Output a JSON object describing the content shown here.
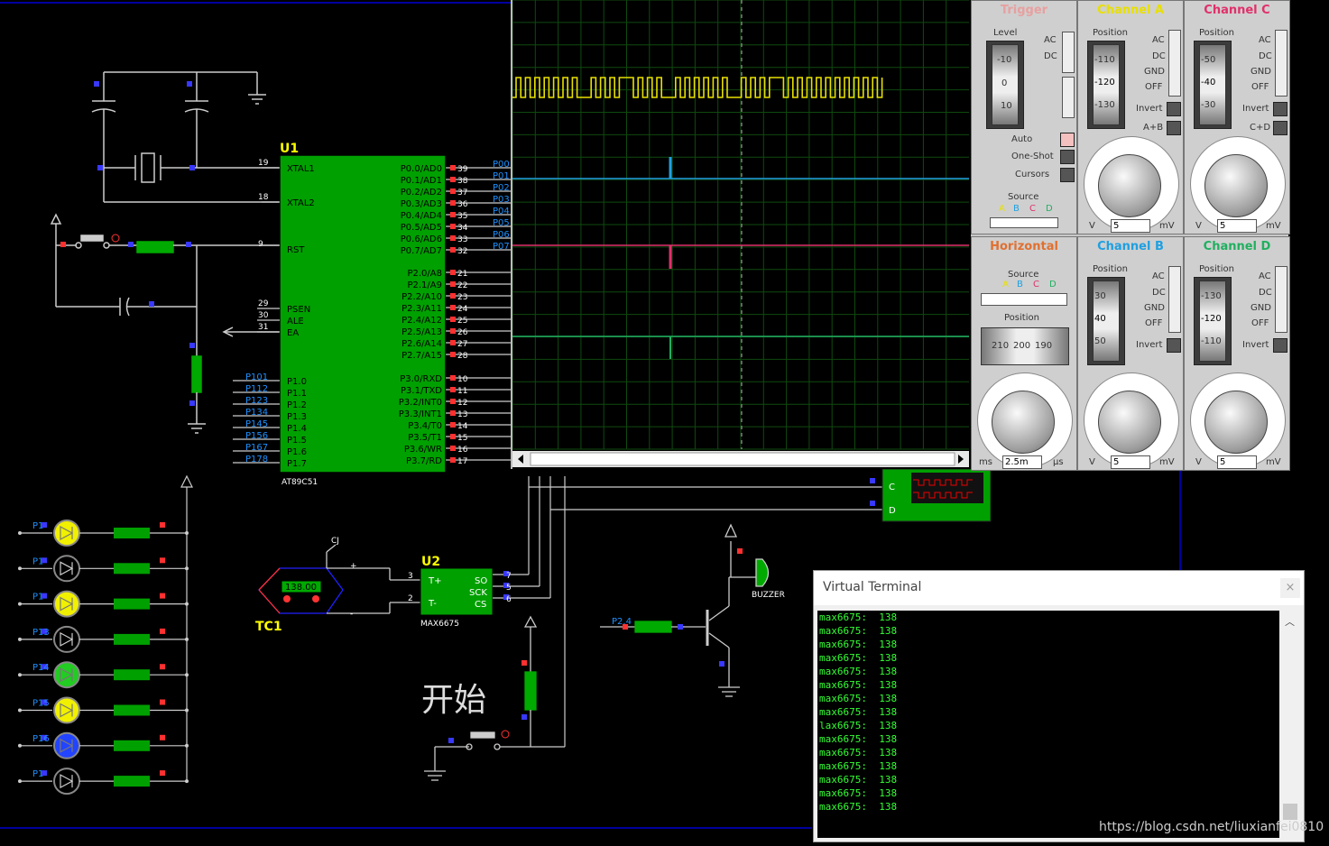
{
  "mcu": {
    "ref": "U1",
    "part": "AT89C51",
    "left_pins": [
      {
        "num": "19",
        "name": "XTAL1"
      },
      {
        "num": "18",
        "name": "XTAL2"
      },
      {
        "num": "9",
        "name": "RST"
      },
      {
        "num": "29",
        "name": "PSEN"
      },
      {
        "num": "30",
        "name": "ALE"
      },
      {
        "num": "31",
        "name": "EA"
      },
      {
        "num": "",
        "name": "P1.0"
      },
      {
        "num": "",
        "name": "P1.1"
      },
      {
        "num": "",
        "name": "P1.2"
      },
      {
        "num": "",
        "name": "P1.3"
      },
      {
        "num": "",
        "name": "P1.4"
      },
      {
        "num": "",
        "name": "P1.5"
      },
      {
        "num": "",
        "name": "P1.6"
      },
      {
        "num": "",
        "name": "P1.7"
      }
    ],
    "p1_nets": [
      "P101",
      "P112",
      "P123",
      "P134",
      "P145",
      "P156",
      "P167",
      "P178"
    ],
    "right_pins": [
      {
        "num": "39",
        "name": "P0.0/AD0",
        "net": "P00"
      },
      {
        "num": "38",
        "name": "P0.1/AD1",
        "net": "P01"
      },
      {
        "num": "37",
        "name": "P0.2/AD2",
        "net": "P02"
      },
      {
        "num": "36",
        "name": "P0.3/AD3",
        "net": "P03"
      },
      {
        "num": "35",
        "name": "P0.4/AD4",
        "net": "P04"
      },
      {
        "num": "34",
        "name": "P0.5/AD5",
        "net": "P05"
      },
      {
        "num": "33",
        "name": "P0.6/AD6",
        "net": "P06"
      },
      {
        "num": "32",
        "name": "P0.7/AD7",
        "net": "P07"
      },
      {
        "num": "21",
        "name": "P2.0/A8",
        "net": ""
      },
      {
        "num": "22",
        "name": "P2.1/A9",
        "net": ""
      },
      {
        "num": "23",
        "name": "P2.2/A10",
        "net": ""
      },
      {
        "num": "24",
        "name": "P2.3/A11",
        "net": ""
      },
      {
        "num": "25",
        "name": "P2.4/A12",
        "net": ""
      },
      {
        "num": "26",
        "name": "P2.5/A13",
        "net": ""
      },
      {
        "num": "27",
        "name": "P2.6/A14",
        "net": ""
      },
      {
        "num": "28",
        "name": "P2.7/A15",
        "net": ""
      },
      {
        "num": "10",
        "name": "P3.0/RXD",
        "net": ""
      },
      {
        "num": "11",
        "name": "P3.1/TXD",
        "net": ""
      },
      {
        "num": "12",
        "name": "P3.2/INT0",
        "net": ""
      },
      {
        "num": "13",
        "name": "P3.3/INT1",
        "net": ""
      },
      {
        "num": "14",
        "name": "P3.4/T0",
        "net": ""
      },
      {
        "num": "15",
        "name": "P3.5/T1",
        "net": ""
      },
      {
        "num": "16",
        "name": "P3.6/WR",
        "net": ""
      },
      {
        "num": "17",
        "name": "P3.7/RD",
        "net": ""
      }
    ]
  },
  "sensor": {
    "ref": "U2",
    "part": "MAX6675",
    "pins_left": [
      {
        "num": "3",
        "name": "T+"
      },
      {
        "num": "2",
        "name": "T-"
      }
    ],
    "pins_right": [
      {
        "num": "7",
        "name": "SO"
      },
      {
        "num": "6",
        "name": "SCK"
      },
      {
        "num": "6",
        "name": "CS"
      }
    ],
    "tc_ref": "TC1",
    "tc_value": "138.00",
    "cj": "CJ",
    "plus": "+",
    "minus": "-"
  },
  "leds": [
    "P1",
    "P1",
    "P1",
    "P13",
    "P14",
    "P15",
    "P16",
    "P1"
  ],
  "led_colors": [
    "#f0f000",
    "#000000",
    "#f0f000",
    "#000000",
    "#22cc22",
    "#f0f000",
    "#2244ff",
    "#000000"
  ],
  "start_label": "开始",
  "buzzer": {
    "label": "BUZZER",
    "net": "P2.4"
  },
  "scope": {
    "trigger": {
      "title": "Trigger",
      "level": "Level",
      "ac": "AC",
      "dc": "DC",
      "scale": [
        "-10",
        "0",
        "10"
      ],
      "auto": "Auto",
      "oneshot": "One-Shot",
      "cursors": "Cursors",
      "source": "Source",
      "srcs": [
        "A",
        "B",
        "C",
        "D"
      ]
    },
    "horizontal": {
      "title": "Horizontal",
      "source": "Source",
      "srcs": [
        "A",
        "B",
        "C",
        "D"
      ],
      "position": "Position",
      "pos_scale": [
        "210",
        "200",
        "190"
      ],
      "left_unit": "ms",
      "value": "2.5m",
      "right_unit": "μs"
    },
    "channels": [
      {
        "title": "Channel A",
        "color": "#e8e000",
        "position": "Position",
        "scale": [
          "-110",
          "-120",
          "-130"
        ],
        "opts": [
          "AC",
          "DC",
          "GND",
          "OFF"
        ],
        "invert": "Invert",
        "extra": "A+B",
        "value": "5",
        "v": "V",
        "mv": "mV"
      },
      {
        "title": "Channel C",
        "color": "#e0306a",
        "position": "Position",
        "scale": [
          "-50",
          "-40",
          "-30"
        ],
        "opts": [
          "AC",
          "DC",
          "GND",
          "OFF"
        ],
        "invert": "Invert",
        "extra": "C+D",
        "value": "5",
        "v": "V",
        "mv": "mV"
      },
      {
        "title": "Channel B",
        "color": "#20a0e0",
        "position": "Position",
        "scale": [
          "30",
          "40",
          "50"
        ],
        "opts": [
          "AC",
          "DC",
          "GND",
          "OFF"
        ],
        "invert": "Invert",
        "extra": "",
        "value": "5",
        "v": "V",
        "mv": "mV"
      },
      {
        "title": "Channel D",
        "color": "#20b060",
        "position": "Position",
        "scale": [
          "-130",
          "-120",
          "-110"
        ],
        "opts": [
          "AC",
          "DC",
          "GND",
          "OFF"
        ],
        "invert": "Invert",
        "extra": "",
        "value": "5",
        "v": "V",
        "mv": "mV"
      }
    ]
  },
  "logic_probe": {
    "c": "C",
    "d": "D"
  },
  "terminal": {
    "title": "Virtual Terminal",
    "close": "×",
    "lines": [
      "max6675:  138",
      "max6675:  138",
      "max6675:  138",
      "max6675:  138",
      "max6675:  138",
      "max6675:  138",
      "max6675:  138",
      "max6675:  138",
      "lax6675:  138",
      "max6675:  138",
      "max6675:  138",
      "max6675:  138",
      "max6675:  138",
      "max6675:  138",
      "max6675:  138"
    ]
  },
  "watermark": "https://blog.csdn.net/liuxianfei0810"
}
